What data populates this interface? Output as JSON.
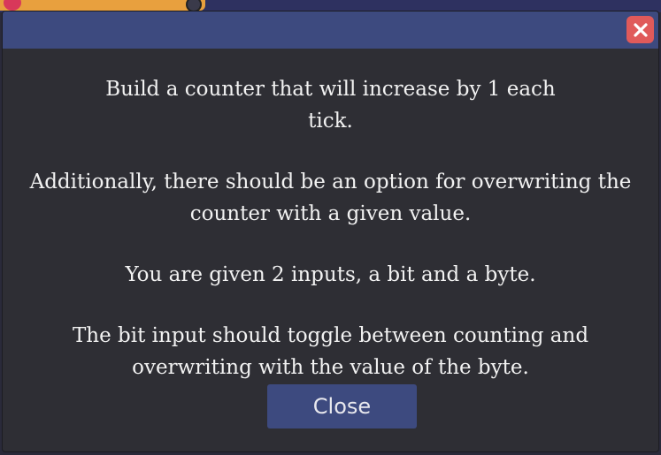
{
  "dialog": {
    "paragraphs": [
      "Build a counter that will increase by 1 each tick.",
      "Additionally, there should be an option for overwriting the counter with a given value.",
      "You are given 2 inputs, a bit and a byte.",
      "The bit input should toggle between counting and overwriting with the value of the byte."
    ],
    "close_button_label": "Close",
    "close_icon": "close-x-icon"
  },
  "colors": {
    "titlebar": "#3d4a7f",
    "body": "#2e2e34",
    "close_icon_bg": "#e05a5a",
    "button": "#3d4a7f",
    "text": "#f2f2f2"
  }
}
